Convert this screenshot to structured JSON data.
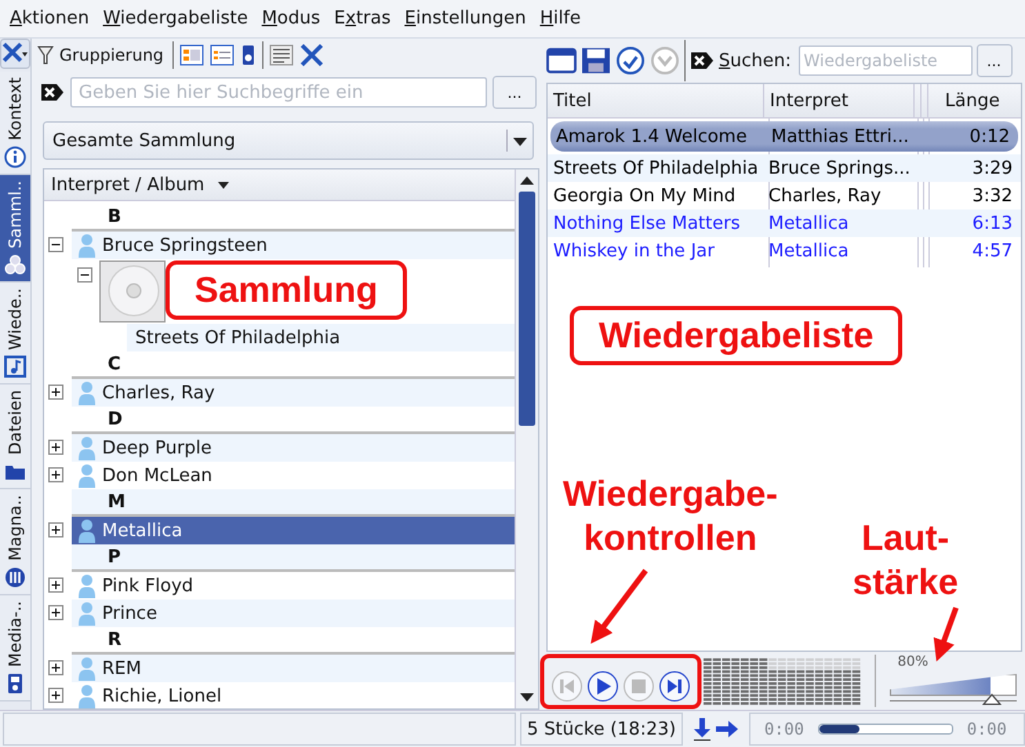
{
  "menu": [
    {
      "key": "A",
      "post": "ktionen"
    },
    {
      "key": "W",
      "post": "iedergabeliste"
    },
    {
      "key": "M",
      "post": "odus"
    },
    {
      "pre": "E",
      "key": "x",
      "post": "tras"
    },
    {
      "key": "E",
      "post": "instellungen"
    },
    {
      "key": "H",
      "post": "ilfe"
    }
  ],
  "side_tabs": [
    {
      "label": "Kontext",
      "selected": false
    },
    {
      "label": "Samml..",
      "selected": true
    },
    {
      "label": "Wiede..",
      "selected": false
    },
    {
      "label": "Dateien",
      "selected": false
    },
    {
      "label": "Magna..",
      "selected": false
    },
    {
      "label": "Media-..",
      "selected": false
    }
  ],
  "collection": {
    "grouping": "Gruppierung",
    "search_placeholder": "Geben Sie hier Suchbegriffe ein",
    "more_button": "...",
    "filter": "Gesamte Sammlung",
    "column": "Interpret / Album",
    "items": [
      {
        "kind": "letter",
        "label": "B"
      },
      {
        "kind": "artist",
        "label": "Bruce Springsteen",
        "expanded": true,
        "selected": false,
        "children": [
          {
            "kind": "album",
            "expanded": true,
            "children": [
              {
                "kind": "track",
                "label": "Streets Of Philadelphia"
              }
            ]
          }
        ]
      },
      {
        "kind": "letter",
        "label": "C"
      },
      {
        "kind": "artist",
        "label": "Charles, Ray",
        "expanded": false,
        "selected": false
      },
      {
        "kind": "letter",
        "label": "D"
      },
      {
        "kind": "artist",
        "label": "Deep Purple",
        "expanded": false,
        "selected": false
      },
      {
        "kind": "artist",
        "label": "Don McLean",
        "expanded": false,
        "selected": false
      },
      {
        "kind": "letter",
        "label": "M"
      },
      {
        "kind": "artist",
        "label": "Metallica",
        "expanded": false,
        "selected": true
      },
      {
        "kind": "letter",
        "label": "P"
      },
      {
        "kind": "artist",
        "label": "Pink Floyd",
        "expanded": false,
        "selected": false
      },
      {
        "kind": "artist",
        "label": "Prince",
        "expanded": false,
        "selected": false
      },
      {
        "kind": "letter",
        "label": "R"
      },
      {
        "kind": "artist",
        "label": "REM",
        "expanded": false,
        "selected": false
      },
      {
        "kind": "artist",
        "label": "Richie, Lionel",
        "expanded": false,
        "selected": false
      }
    ]
  },
  "playlist": {
    "search_key": "S",
    "search_label_post": "uchen:",
    "search_placeholder": "Wiedergabeliste",
    "more_button": "...",
    "columns": [
      "Titel",
      "Interpret",
      "Länge"
    ],
    "rows": [
      {
        "title": "Amarok 1.4 Welcome",
        "artist": "Matthias Ettri...",
        "length": "0:12",
        "current": true,
        "color": "#000000"
      },
      {
        "title": "Streets Of Philadelphia",
        "artist": "Bruce Springs...",
        "length": "3:29",
        "current": false,
        "color": "#000000"
      },
      {
        "title": "Georgia On My Mind",
        "artist": "Charles, Ray",
        "length": "3:32",
        "current": false,
        "color": "#000000"
      },
      {
        "title": "Nothing Else Matters",
        "artist": "Metallica",
        "length": "6:13",
        "current": false,
        "color": "#1a1aff"
      },
      {
        "title": "Whiskey in the Jar",
        "artist": "Metallica",
        "length": "4:57",
        "current": false,
        "color": "#1a1aff"
      }
    ]
  },
  "controls": [
    {
      "kind": "previous",
      "disabled": true
    },
    {
      "kind": "play",
      "disabled": false
    },
    {
      "kind": "stop",
      "disabled": true
    },
    {
      "kind": "next",
      "disabled": false
    }
  ],
  "volume": {
    "reading": "80%",
    "level": 0.8
  },
  "status_bar": {
    "count": "5 Stücke (18:23)",
    "elapsed": "0:00",
    "remaining": "0:00",
    "seek": {
      "level": 0.3
    }
  },
  "annotations": [
    {
      "kind": "box",
      "lines": [
        "Sammlung"
      ]
    },
    {
      "kind": "box",
      "lines": [
        "Wiedergabeliste"
      ]
    },
    {
      "kind": "arrow-label",
      "lines": [
        "Wiedergabe-",
        "kontrollen"
      ]
    },
    {
      "kind": "arrow-label",
      "lines": [
        "Laut-",
        "stärke"
      ]
    }
  ]
}
